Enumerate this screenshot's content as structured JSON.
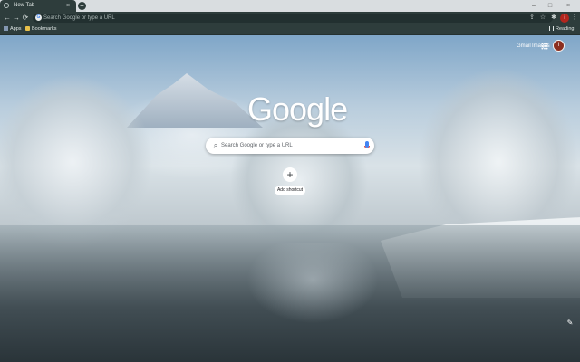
{
  "tab": {
    "title": "New Tab",
    "close": "×"
  },
  "new_tab": {
    "label": "+"
  },
  "window_controls": {
    "minimize": "–",
    "maximize": "□",
    "close": "×"
  },
  "nav": {
    "back": "←",
    "forward": "→",
    "reload": "⟳"
  },
  "omnibox": {
    "placeholder": "Search Google or type a URL",
    "google_letter": "G",
    "star": "☆"
  },
  "toolbar_icons": {
    "share": "⇪",
    "bookmark": "☆",
    "extensions": "✱",
    "profile": "i",
    "menu": "⋮"
  },
  "bookmarks": {
    "apps": "Apps",
    "bookmarks": "Bookmarks",
    "reading_list": "Reading list"
  },
  "top_links": {
    "gmail": "Gmail",
    "images": "Images",
    "avatar_letter": "i"
  },
  "logo": {
    "text": "Google"
  },
  "search": {
    "placeholder": "Search Google or type a URL",
    "icon": "⌕"
  },
  "shortcut": {
    "plus": "+",
    "label": "Add shortcut"
  },
  "customize": {
    "icon": "✎"
  }
}
